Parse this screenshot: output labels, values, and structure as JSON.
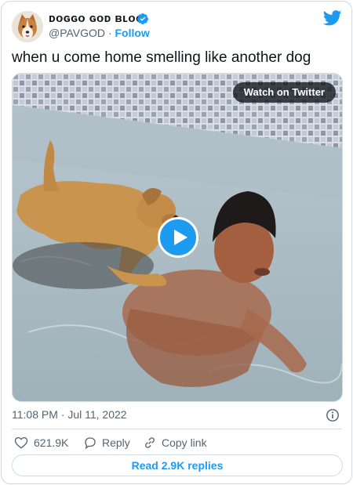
{
  "tweet": {
    "display_name": "ᴅᴏɢɢᴏ ɢᴏᴅ ʙʟᴏɢ",
    "handle": "@PAVGOD",
    "separator": "·",
    "follow_label": "Follow",
    "text": "when u come home smelling like another dog",
    "timestamp": "11:08 PM · Jul 11, 2022",
    "likes": "621.9K",
    "reply_label": "Reply",
    "copy_link_label": "Copy link",
    "read_replies_label": "Read 2.9K replies"
  },
  "media": {
    "watch_label": "Watch on Twitter"
  },
  "icons": {
    "avatar": "dog-avatar",
    "verified": "verified-badge-icon",
    "logo": "twitter-bird-icon",
    "play": "play-icon",
    "info": "info-icon",
    "like": "heart-icon",
    "reply": "reply-bubble-icon",
    "copy_link": "link-icon"
  },
  "colors": {
    "accent": "#1d9bf0",
    "text": "#0f1419",
    "muted": "#536471",
    "border": "#cfd9de"
  }
}
